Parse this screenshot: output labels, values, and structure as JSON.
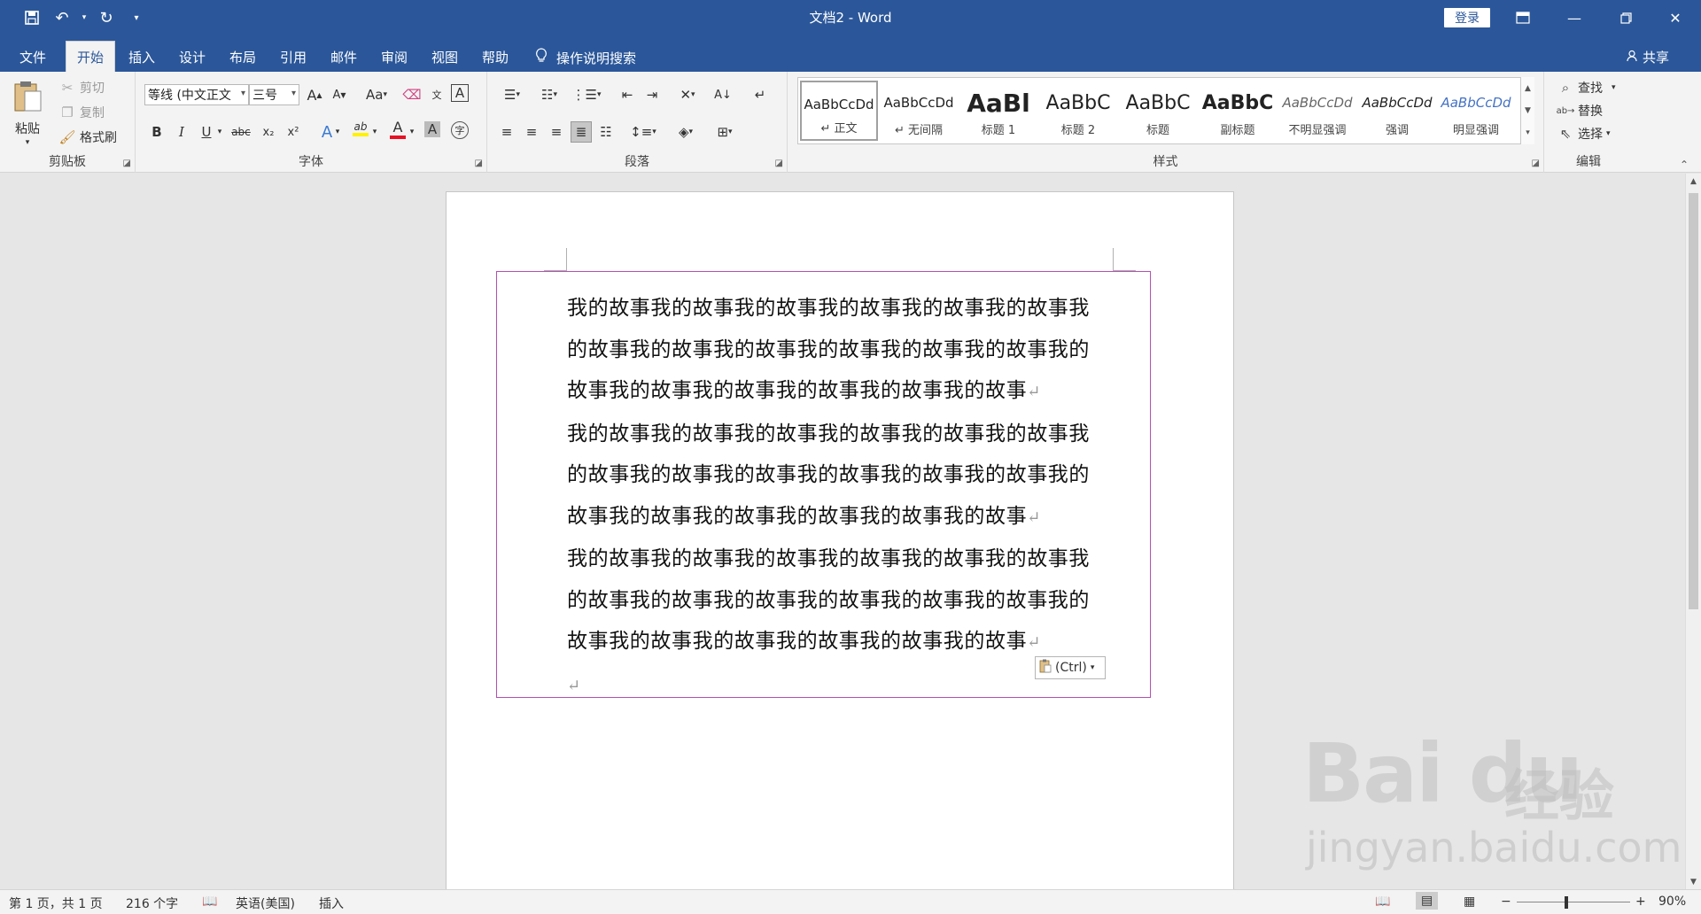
{
  "app": {
    "title": "文档2  -  Word",
    "login": "登录"
  },
  "tabs": [
    "文件",
    "开始",
    "插入",
    "设计",
    "布局",
    "引用",
    "邮件",
    "审阅",
    "视图",
    "帮助"
  ],
  "tell_me": "操作说明搜索",
  "share": "共享",
  "clipboard": {
    "label": "剪贴板",
    "paste": "粘贴",
    "cut": "剪切",
    "copy": "复制",
    "format_painter": "格式刷"
  },
  "font": {
    "label": "字体",
    "font_name": "等线 (中文正文",
    "font_size": "三号",
    "bold": "B",
    "italic": "I",
    "underline": "U",
    "strike": "abc",
    "sub": "x₂",
    "sup": "x²",
    "grow": "A",
    "shrink": "A",
    "case": "Aa",
    "font_color": "A",
    "highlight": "ab"
  },
  "paragraph": {
    "label": "段落"
  },
  "styles": {
    "label": "样式",
    "items": [
      {
        "sample": "AaBbCcDd",
        "name": "↵ 正文"
      },
      {
        "sample": "AaBbCcDd",
        "name": "↵ 无间隔"
      },
      {
        "sample": "AaBl",
        "name": "标题 1"
      },
      {
        "sample": "AaBbC",
        "name": "标题 2"
      },
      {
        "sample": "AaBbC",
        "name": "标题"
      },
      {
        "sample": "AaBbC",
        "name": "副标题"
      },
      {
        "sample": "AaBbCcDd",
        "name": "不明显强调"
      },
      {
        "sample": "AaBbCcDd",
        "name": "强调"
      },
      {
        "sample": "AaBbCcDd",
        "name": "明显强调"
      }
    ]
  },
  "editing": {
    "label": "编辑",
    "find": "查找",
    "replace": "替换",
    "select": "选择"
  },
  "document": {
    "lines": [
      "我的故事我的故事我的故事我的故事我的故事我的故事我",
      "的故事我的故事我的故事我的故事我的故事我的故事我的",
      "故事我的故事我的故事我的故事我的故事我的故事",
      "我的故事我的故事我的故事我的故事我的故事我的故事我",
      "的故事我的故事我的故事我的故事我的故事我的故事我的",
      "故事我的故事我的故事我的故事我的故事我的故事",
      "我的故事我的故事我的故事我的故事我的故事我的故事我",
      "的故事我的故事我的故事我的故事我的故事我的故事我的",
      "故事我的故事我的故事我的故事我的故事我的故事"
    ],
    "paste_options": "(Ctrl)"
  },
  "status": {
    "page": "第 1 页，共 1 页",
    "words": "216 个字",
    "language": "英语(美国)",
    "mode": "插入",
    "zoom": "90%"
  },
  "watermark": {
    "logo": "Bai  du",
    "cn": "经验",
    "url": "jingyan.baidu.com"
  },
  "colors": {
    "brand": "#2b579a",
    "frame": "#b34fb3",
    "font_color_bar": "#e81123",
    "highlight_bar": "#fff100"
  }
}
